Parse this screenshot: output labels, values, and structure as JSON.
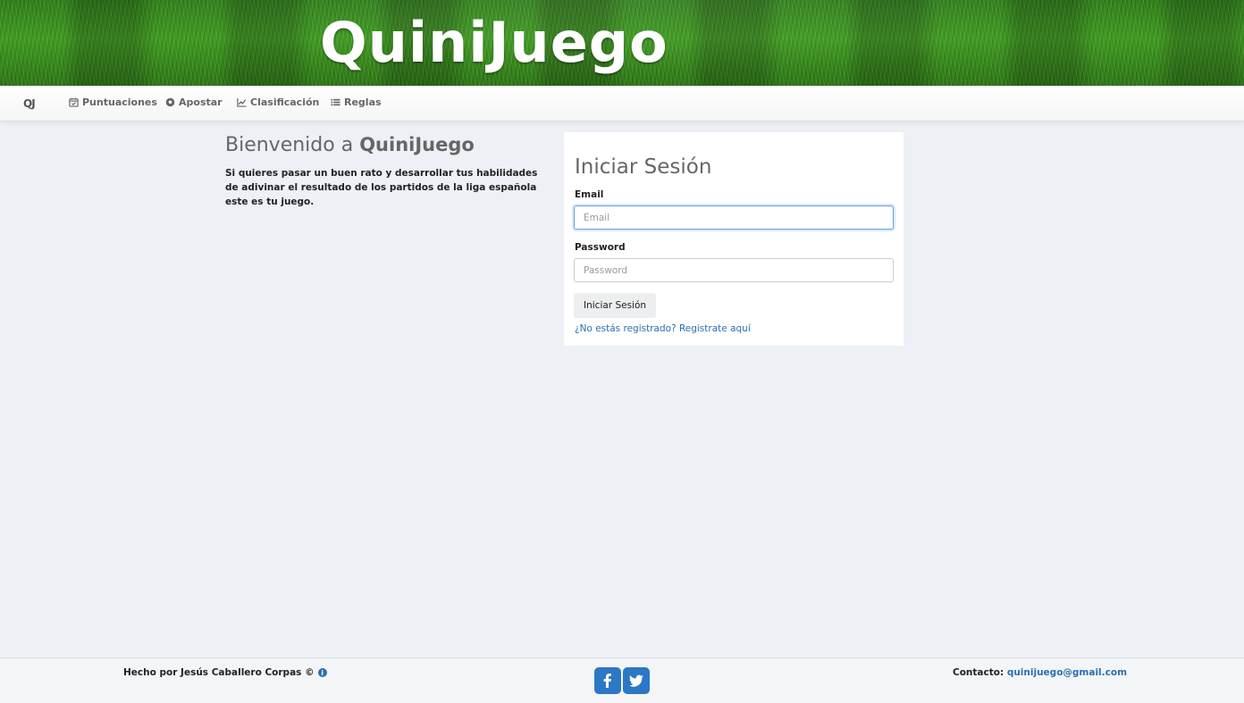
{
  "header": {
    "logo_text": "QuiniJuego"
  },
  "navbar": {
    "brand": "QJ",
    "items": [
      {
        "label": "Puntuaciones",
        "icon": "calendar-check-icon"
      },
      {
        "label": "Apostar",
        "icon": "soccer-ball-icon"
      },
      {
        "label": "Clasificación",
        "icon": "line-chart-icon"
      },
      {
        "label": "Reglas",
        "icon": "list-icon"
      }
    ]
  },
  "welcome": {
    "title_prefix": "Bienvenido a",
    "title_brand": "QuiniJuego",
    "text": "Si quieres pasar un buen rato y desarrollar tus habilidades de adivinar el resultado de los partidos de la liga española este es tu juego."
  },
  "login": {
    "title": "Iniciar Sesión",
    "email_label": "Email",
    "email_placeholder": "Email",
    "password_label": "Password",
    "password_placeholder": "Password",
    "submit_label": "Iniciar Sesión",
    "register_link": "¿No estás registrado? Registrate aquí"
  },
  "footer": {
    "credit": "Hecho por Jesús Caballero Corpas ©",
    "contact_label": "Contacto:",
    "contact_email": "quinijuego@gmail.com",
    "social": [
      "facebook-icon",
      "twitter-icon"
    ]
  },
  "colors": {
    "link": "#2a6fb3",
    "background": "#edf0f4",
    "social": "#2b78c4"
  }
}
